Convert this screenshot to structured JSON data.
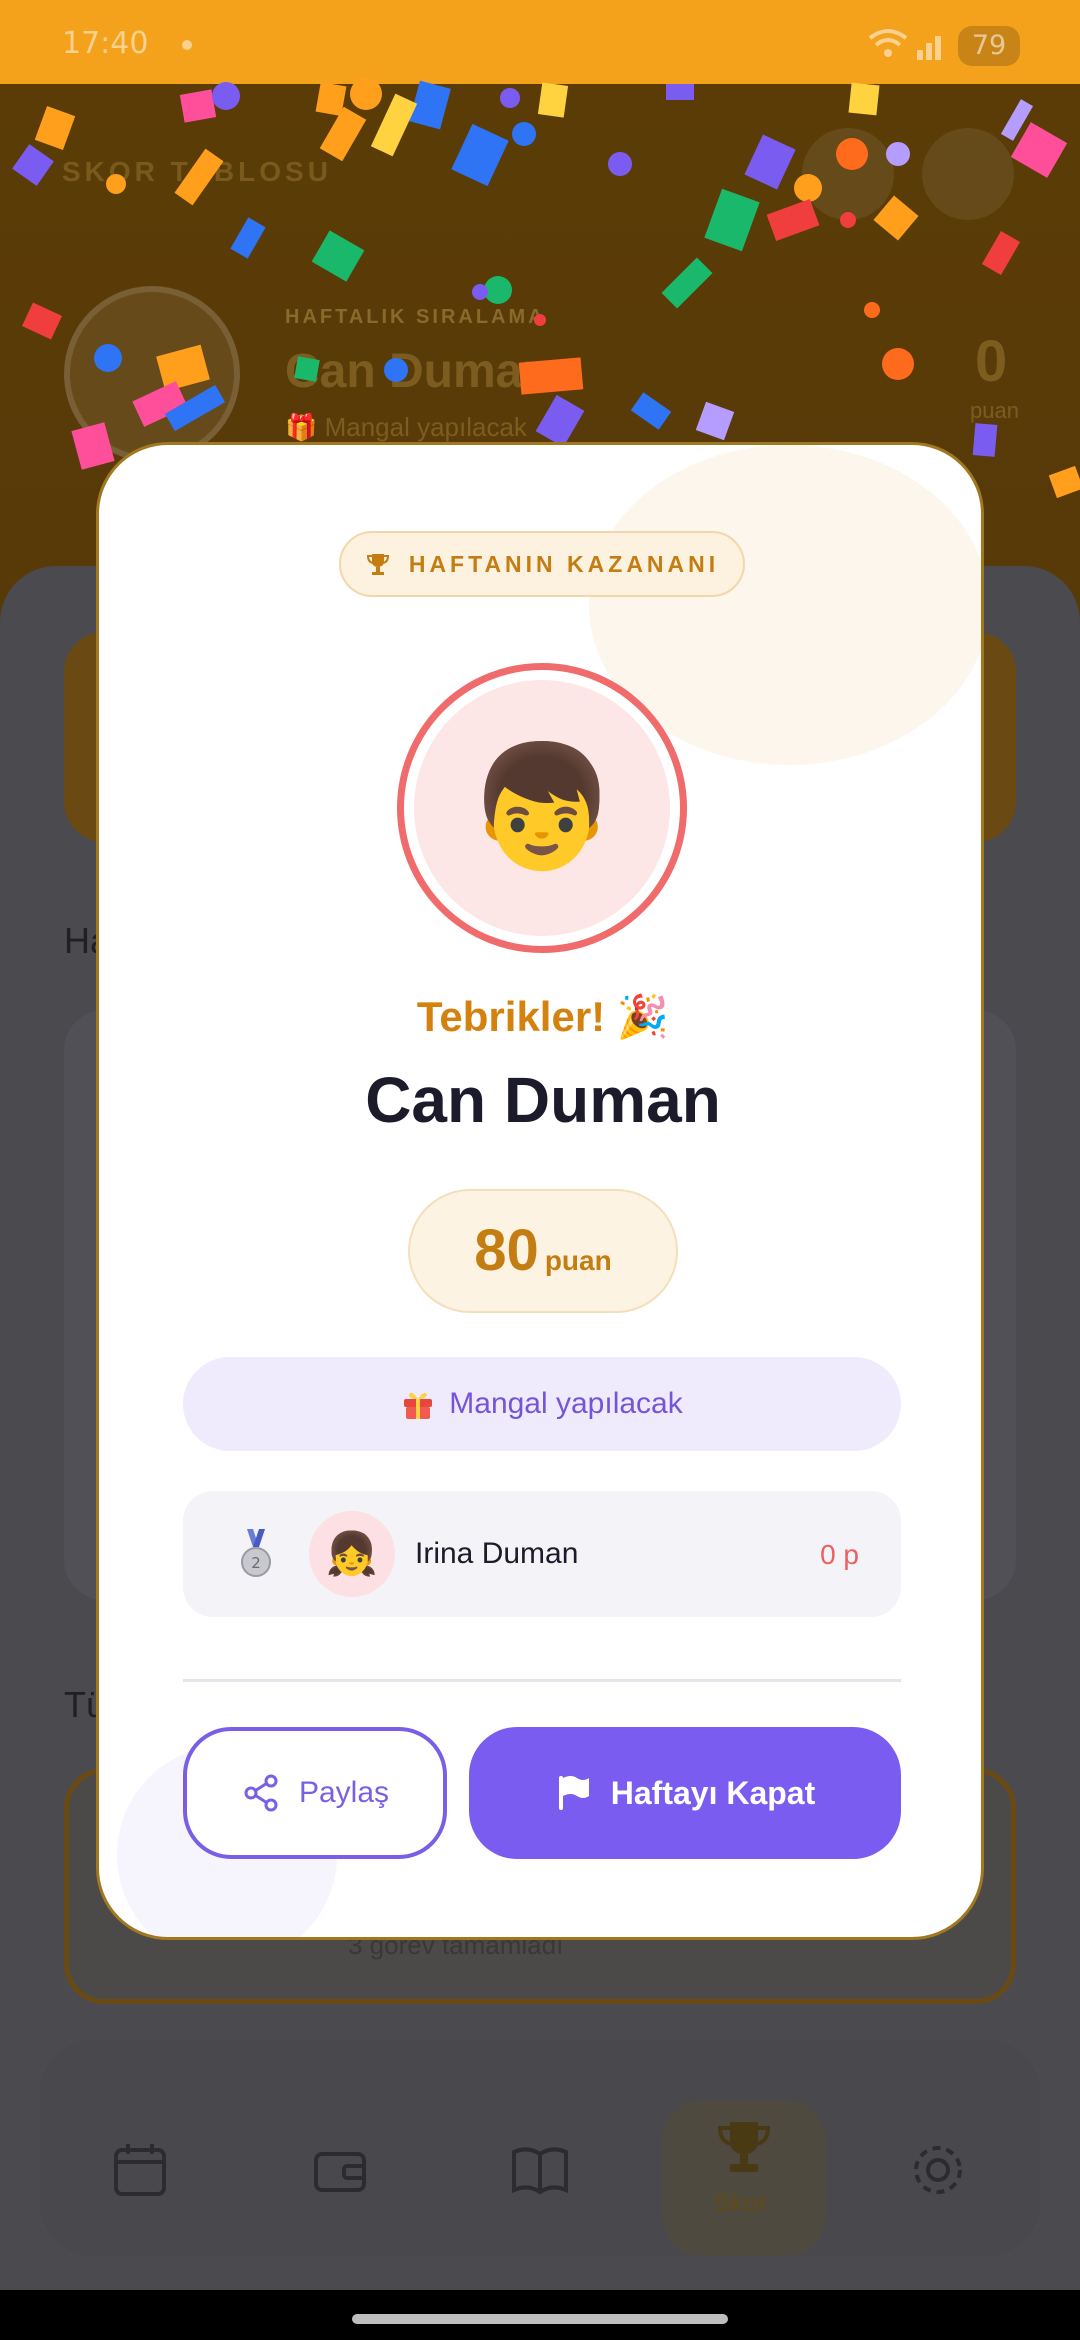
{
  "status_bar": {
    "time": "17:40",
    "battery": "79",
    "icons": [
      "wifi-icon",
      "signal-icon",
      "battery-icon"
    ]
  },
  "background": {
    "title": "SKOR TABLOSU",
    "weekly_label": "HAFTALIK SIRALAMA",
    "leader_name": "Can Duman",
    "leader_reward": "🎁 Mangal yapılacak",
    "leader_points": "0",
    "points_label": "puan",
    "section_weekly": "Ha",
    "section_all": "Tü",
    "task_text": "3 görev tamamladı",
    "nav": [
      {
        "icon": "calendar-icon",
        "label": ""
      },
      {
        "icon": "wallet-icon",
        "label": ""
      },
      {
        "icon": "book-icon",
        "label": ""
      },
      {
        "icon": "trophy-icon",
        "label": "Skor"
      },
      {
        "icon": "gear-icon",
        "label": ""
      }
    ]
  },
  "modal": {
    "badge": "HAFTANIN KAZANANI",
    "winner_avatar": "👦",
    "congrats": "Tebrikler! 🎉",
    "winner_name": "Can Duman",
    "score": "80",
    "score_unit": "puan",
    "reward": "Mangal yapılacak",
    "runner_up": {
      "avatar": "👧",
      "name": "Irina Duman",
      "points": "0 p"
    },
    "share_label": "Paylaş",
    "close_week_label": "Haftayı Kapat"
  },
  "colors": {
    "accent": "#7b5cf0",
    "gold": "#c47d12",
    "status_bar": "#f4a21c",
    "winner_ring": "#f06b6b"
  }
}
